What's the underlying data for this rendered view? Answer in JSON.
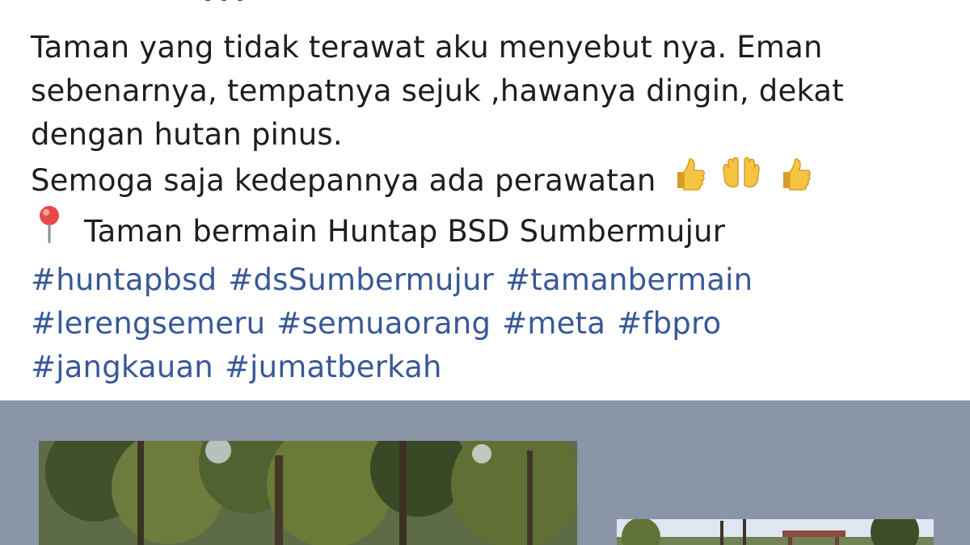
{
  "post": {
    "lines": [
      "Taman yang tidak terawat aku menyebut nya. Eman",
      "sebenarnya, tempatnya sejuk ,hawanya dingin, dekat",
      "dengan hutan pinus.",
      "Semoga saja kedepannya ada perawatan"
    ],
    "location": "Taman bermain Huntap BSD Sumbermujur",
    "hashtags": [
      [
        "#huntapbsd",
        "#dsSumbermujur",
        "#tamanbermain"
      ],
      [
        "#lerengsemeru",
        "#semuaorang",
        "#meta",
        "#fbpro"
      ],
      [
        "#jangkauan",
        "#jumatberkah"
      ]
    ],
    "emoji_icons": [
      "thumbs-up-icon",
      "open-hands-icon",
      "thumbs-up-icon"
    ],
    "location_icon": "round-pushpin-icon"
  },
  "colors": {
    "text": "#1c1e21",
    "hashtag": "#385898",
    "media_background": "#8a95a8"
  }
}
